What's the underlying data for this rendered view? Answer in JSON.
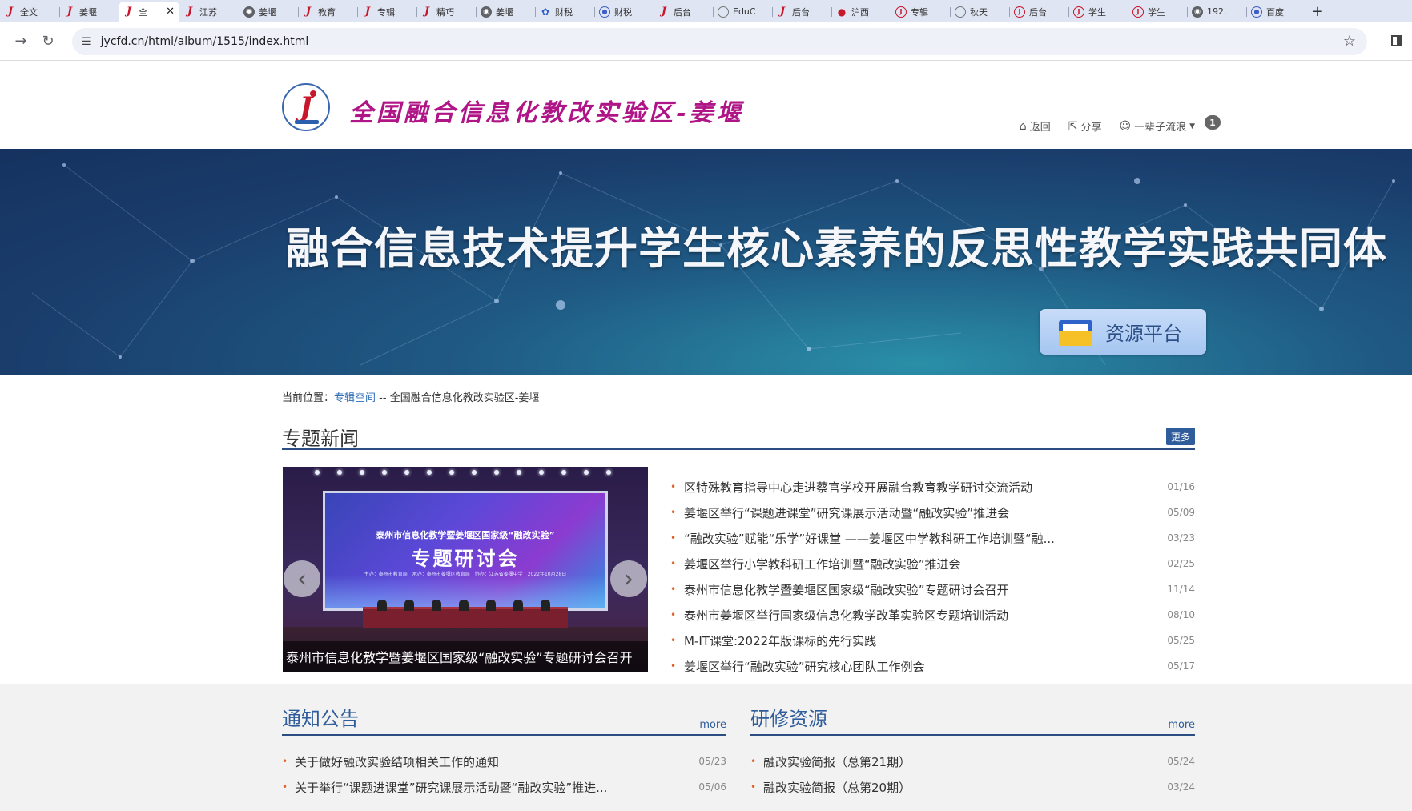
{
  "browser": {
    "tabs": [
      {
        "label": "全文",
        "icon": "brand"
      },
      {
        "label": "姜堰",
        "icon": "brand"
      },
      {
        "label": "全",
        "icon": "brand",
        "active": true
      },
      {
        "label": "江苏",
        "icon": "brand"
      },
      {
        "label": "姜堰",
        "icon": "globe"
      },
      {
        "label": "教育",
        "icon": "brand"
      },
      {
        "label": "专辑",
        "icon": "brand"
      },
      {
        "label": "精巧",
        "icon": "brand"
      },
      {
        "label": "姜堰",
        "icon": "globe"
      },
      {
        "label": "财税",
        "icon": "paw"
      },
      {
        "label": "财税",
        "icon": "blue-ring"
      },
      {
        "label": "后台",
        "icon": "brand"
      },
      {
        "label": "EduC",
        "icon": "circle-o"
      },
      {
        "label": "后台",
        "icon": "brand"
      },
      {
        "label": "沪西",
        "icon": "pin"
      },
      {
        "label": "专辑",
        "icon": "ring"
      },
      {
        "label": "秋天",
        "icon": "circle-o"
      },
      {
        "label": "后台",
        "icon": "ring"
      },
      {
        "label": "学生",
        "icon": "ring"
      },
      {
        "label": "学生",
        "icon": "ring"
      },
      {
        "label": "192.",
        "icon": "globe"
      },
      {
        "label": "百度",
        "icon": "blue-ring"
      }
    ],
    "new_tab": "+",
    "url": "jycfd.cn/html/album/1515/index.html"
  },
  "header": {
    "site_title": "全国融合信息化教改实验区-姜堰",
    "links": {
      "back": "返回",
      "share": "分享",
      "user": "一辈子流浪"
    },
    "notification_count": "1"
  },
  "banner": {
    "title": "融合信息技术提升学生核心素养的反思性教学实践共同体",
    "resource_button": "资源平台"
  },
  "breadcrumb": {
    "prefix": "当前位置：",
    "link": "专辑空间",
    "separator": " -- ",
    "current": "全国融合信息化教改实验区-姜堰"
  },
  "news": {
    "title": "专题新闻",
    "more": "更多",
    "slide": {
      "caption": "泰州市信息化教学暨姜堰区国家级“融改实验”专题研讨会召开",
      "screen_line1": "泰州市信息化教学暨姜堰区国家级“融改实验”",
      "screen_line2": "专题研讨会",
      "screen_line3": "主办：泰州市教育局　承办：泰州市姜堰区教育局　协办：江苏省姜堰中学　2022年10月28日"
    },
    "items": [
      {
        "title": "区特殊教育指导中心走进蔡官学校开展融合教育教学研讨交流活动",
        "date": "01/16"
      },
      {
        "title": "姜堰区举行“课题进课堂”研究课展示活动暨“融改实验”推进会",
        "date": "05/09"
      },
      {
        "title": "“融改实验”赋能“乐学”好课堂 ——姜堰区中学教科研工作培训暨“融...",
        "date": "03/23"
      },
      {
        "title": "姜堰区举行小学教科研工作培训暨“融改实验”推进会",
        "date": "02/25"
      },
      {
        "title": "泰州市信息化教学暨姜堰区国家级“融改实验”专题研讨会召开",
        "date": "11/14"
      },
      {
        "title": "泰州市姜堰区举行国家级信息化教学改革实验区专题培训活动",
        "date": "08/10"
      },
      {
        "title": "M-IT课堂:2022年版课标的先行实践",
        "date": "05/25"
      },
      {
        "title": "姜堰区举行“融改实验”研究核心团队工作例会",
        "date": "05/17"
      }
    ]
  },
  "notices": {
    "title": "通知公告",
    "more": "more",
    "items": [
      {
        "title": "关于做好融改实验结项相关工作的通知",
        "date": "05/23"
      },
      {
        "title": "关于举行“课题进课堂”研究课展示活动暨“融改实验”推进...",
        "date": "05/06"
      }
    ]
  },
  "resources": {
    "title": "研修资源",
    "more": "more",
    "items": [
      {
        "title": "融改实验简报（总第21期）",
        "date": "05/24"
      },
      {
        "title": "融改实验简报（总第20期）",
        "date": "03/24"
      }
    ]
  }
}
